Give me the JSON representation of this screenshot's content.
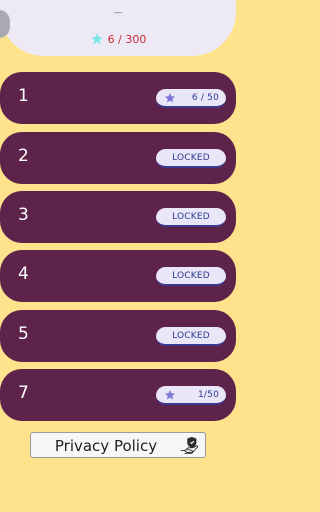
{
  "header": {
    "title": "—",
    "progress_text": "6 / 300",
    "star_icon": "star-icon",
    "back_icon": "back-icon"
  },
  "levels": [
    {
      "number": "1",
      "status": "6 / 50",
      "unlocked": true
    },
    {
      "number": "2",
      "status": "LOCKED",
      "unlocked": false
    },
    {
      "number": "3",
      "status": "LOCKED",
      "unlocked": false
    },
    {
      "number": "4",
      "status": "LOCKED",
      "unlocked": false
    },
    {
      "number": "5",
      "status": "LOCKED",
      "unlocked": false
    },
    {
      "number": "7",
      "status": "1/50",
      "unlocked": true
    }
  ],
  "footer": {
    "privacy_label": "Privacy Policy",
    "privacy_icon": "privacy-shield-hand-icon"
  },
  "colors": {
    "background": "#FFE38C",
    "card": "#5E234A",
    "pill": "#E9E6F8",
    "pill_text": "#2C3A8F",
    "progress_text": "#C72C35",
    "star_header": "#7FE7E4",
    "star_pill": "#7E79D9"
  }
}
